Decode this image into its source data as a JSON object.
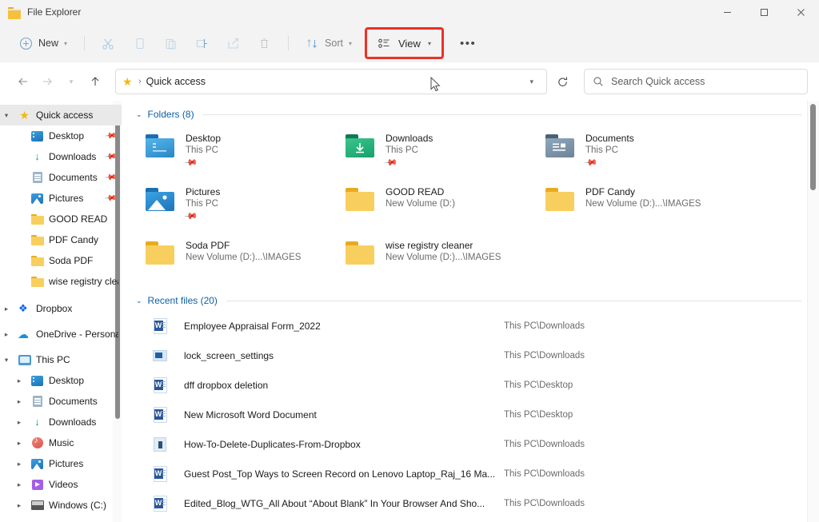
{
  "window": {
    "title": "File Explorer",
    "app_icon": "folder-icon",
    "controls": {
      "minimize": "minimize-icon",
      "maximize": "maximize-icon",
      "close": "close-icon"
    }
  },
  "toolbar": {
    "new_label": "New",
    "sort_label": "Sort",
    "view_label": "View",
    "more_label": "•••",
    "view_highlight_color": "#ee3124",
    "items": [
      {
        "name": "new-button",
        "label": "New",
        "icon": "plus-circle-icon",
        "has_chevron": true
      },
      {
        "name": "cut-button",
        "label": "",
        "icon": "scissors-icon",
        "has_chevron": false
      },
      {
        "name": "copy-button",
        "label": "",
        "icon": "copy-icon",
        "has_chevron": false
      },
      {
        "name": "paste-button",
        "label": "",
        "icon": "clipboard-icon",
        "has_chevron": false
      },
      {
        "name": "rename-button",
        "label": "",
        "icon": "rename-icon",
        "has_chevron": false
      },
      {
        "name": "share-button",
        "label": "",
        "icon": "share-icon",
        "has_chevron": false
      },
      {
        "name": "delete-button",
        "label": "",
        "icon": "trash-icon",
        "has_chevron": false
      },
      {
        "name": "sort-button",
        "label": "Sort",
        "icon": "sort-icon",
        "has_chevron": true
      },
      {
        "name": "view-button",
        "label": "View",
        "icon": "view-icon",
        "has_chevron": true
      },
      {
        "name": "more-button",
        "label": "•••",
        "icon": "ellipsis-icon",
        "has_chevron": false
      }
    ]
  },
  "address": {
    "back": "back-arrow-icon",
    "forward": "forward-arrow-icon",
    "recent_chevron": "chevron-down-icon",
    "up": "up-arrow-icon",
    "crumb_icon": "star-icon",
    "separator": "›",
    "path": "Quick access",
    "dropdown": "chevron-down-icon",
    "refresh": "refresh-icon"
  },
  "search": {
    "icon": "search-icon",
    "placeholder": "Search Quick access",
    "value": ""
  },
  "sidebar": {
    "items": [
      {
        "label": "Quick access",
        "icon": "star-icon",
        "twisty": "⌄",
        "indent": 0,
        "selected": true,
        "pinned": false
      },
      {
        "label": "Desktop",
        "icon": "desktop-icon",
        "twisty": "",
        "indent": 1,
        "selected": false,
        "pinned": true
      },
      {
        "label": "Downloads",
        "icon": "downloads-icon",
        "twisty": "",
        "indent": 1,
        "selected": false,
        "pinned": true
      },
      {
        "label": "Documents",
        "icon": "documents-icon",
        "twisty": "",
        "indent": 1,
        "selected": false,
        "pinned": true
      },
      {
        "label": "Pictures",
        "icon": "pictures-icon",
        "twisty": "",
        "indent": 1,
        "selected": false,
        "pinned": true
      },
      {
        "label": "GOOD READ",
        "icon": "folder-icon",
        "twisty": "",
        "indent": 1,
        "selected": false,
        "pinned": false
      },
      {
        "label": "PDF Candy",
        "icon": "folder-icon",
        "twisty": "",
        "indent": 1,
        "selected": false,
        "pinned": false
      },
      {
        "label": "Soda PDF",
        "icon": "folder-icon",
        "twisty": "",
        "indent": 1,
        "selected": false,
        "pinned": false
      },
      {
        "label": "wise registry clear",
        "icon": "folder-icon",
        "twisty": "",
        "indent": 1,
        "selected": false,
        "pinned": false
      },
      {
        "label": "Dropbox",
        "icon": "dropbox-icon",
        "twisty": "›",
        "indent": 0,
        "selected": false,
        "pinned": false
      },
      {
        "label": "OneDrive - Persona",
        "icon": "onedrive-icon",
        "twisty": "›",
        "indent": 0,
        "selected": false,
        "pinned": false
      },
      {
        "label": "This PC",
        "icon": "pc-icon",
        "twisty": "⌄",
        "indent": 0,
        "selected": false,
        "pinned": false
      },
      {
        "label": "Desktop",
        "icon": "desktop-icon",
        "twisty": "›",
        "indent": 1,
        "selected": false,
        "pinned": false
      },
      {
        "label": "Documents",
        "icon": "documents-icon",
        "twisty": "›",
        "indent": 1,
        "selected": false,
        "pinned": false
      },
      {
        "label": "Downloads",
        "icon": "downloads-icon",
        "twisty": "›",
        "indent": 1,
        "selected": false,
        "pinned": false
      },
      {
        "label": "Music",
        "icon": "music-icon",
        "twisty": "›",
        "indent": 1,
        "selected": false,
        "pinned": false
      },
      {
        "label": "Pictures",
        "icon": "pictures-icon",
        "twisty": "›",
        "indent": 1,
        "selected": false,
        "pinned": false
      },
      {
        "label": "Videos",
        "icon": "videos-icon",
        "twisty": "›",
        "indent": 1,
        "selected": false,
        "pinned": false
      },
      {
        "label": "Windows (C:)",
        "icon": "drive-icon",
        "twisty": "›",
        "indent": 1,
        "selected": false,
        "pinned": false
      }
    ]
  },
  "main": {
    "folders_group": {
      "chevron": "⌄",
      "title": "Folders (8)",
      "items": [
        {
          "name": "Desktop",
          "sub": "This PC",
          "icon": "desktop-folder-icon",
          "pinned": true
        },
        {
          "name": "Downloads",
          "sub": "This PC",
          "icon": "downloads-folder-icon",
          "pinned": true
        },
        {
          "name": "Documents",
          "sub": "This PC",
          "icon": "documents-folder-icon",
          "pinned": true
        },
        {
          "name": "Pictures",
          "sub": "This PC",
          "icon": "pictures-folder-icon",
          "pinned": true
        },
        {
          "name": "GOOD READ",
          "sub": "New Volume (D:)",
          "icon": "folder-icon",
          "pinned": false
        },
        {
          "name": "PDF Candy",
          "sub": "New Volume (D:)...\\IMAGES",
          "icon": "folder-icon",
          "pinned": false
        },
        {
          "name": "Soda PDF",
          "sub": "New Volume (D:)...\\IMAGES",
          "icon": "folder-icon",
          "pinned": false
        },
        {
          "name": "wise registry cleaner",
          "sub": "New Volume (D:)...\\IMAGES",
          "icon": "folder-icon",
          "pinned": false
        }
      ]
    },
    "recent_group": {
      "chevron": "⌄",
      "title": "Recent files (20)",
      "items": [
        {
          "name": "Employee Appraisal Form_2022",
          "path": "This PC\\Downloads",
          "icon": "word-file-icon"
        },
        {
          "name": "lock_screen_settings",
          "path": "This PC\\Downloads",
          "icon": "image-file-icon"
        },
        {
          "name": "dff dropbox deletion",
          "path": "This PC\\Desktop",
          "icon": "word-file-icon"
        },
        {
          "name": "New Microsoft Word Document",
          "path": "This PC\\Desktop",
          "icon": "word-file-icon"
        },
        {
          "name": "How-To-Delete-Duplicates-From-Dropbox",
          "path": "This PC\\Downloads",
          "icon": "pdf-file-icon"
        },
        {
          "name": "Guest Post_Top Ways to Screen Record on Lenovo Laptop_Raj_16 Ma...",
          "path": "This PC\\Downloads",
          "icon": "word-file-icon"
        },
        {
          "name": "Edited_Blog_WTG_All About “About Blank” In Your Browser And Sho...",
          "path": "This PC\\Downloads",
          "icon": "word-file-icon"
        }
      ]
    }
  }
}
